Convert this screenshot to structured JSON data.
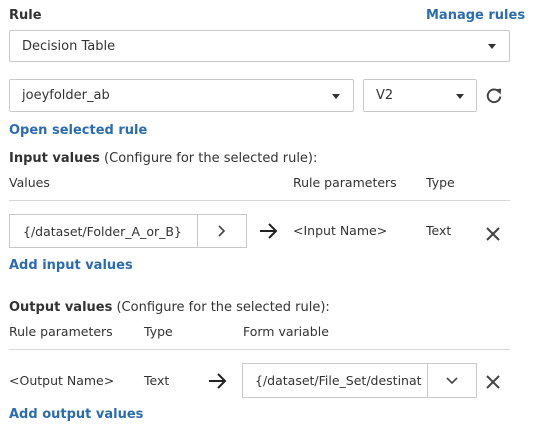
{
  "rule": {
    "label": "Rule",
    "manage_link": "Manage rules",
    "selected": "Decision Table"
  },
  "folder": {
    "selected": "joeyfolder_ab",
    "version": "V2",
    "refresh_icon": "refresh-icon"
  },
  "open_rule_link": "Open selected rule",
  "input": {
    "heading": "Input values",
    "subheading": " (Configure for the selected rule):",
    "headers": {
      "values": "Values",
      "rule_params": "Rule parameters",
      "type": "Type"
    },
    "row": {
      "value": "{/dataset/Folder_A_or_B}",
      "param": "<Input Name>",
      "type": "Text"
    },
    "add_link": "Add input values"
  },
  "output": {
    "heading": "Output values",
    "subheading": " (Configure for the selected rule):",
    "headers": {
      "rule_params": "Rule parameters",
      "type": "Type",
      "form_var": "Form variable"
    },
    "row": {
      "param": "<Output Name>",
      "type": "Text",
      "value": "{/dataset/File_Set/destinat"
    },
    "add_link": "Add output values"
  }
}
